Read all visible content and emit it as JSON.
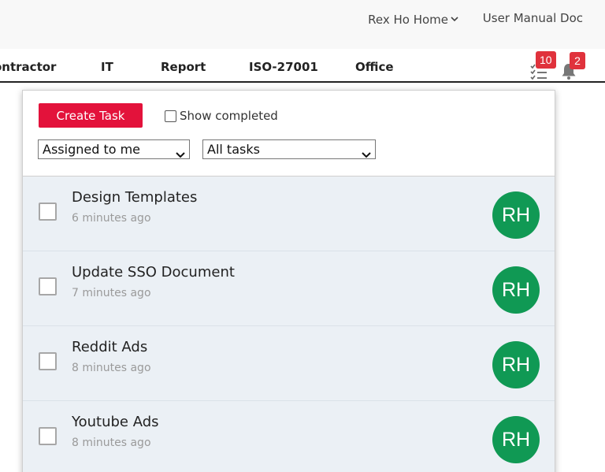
{
  "topbar": {
    "home_label": "Rex Ho Home",
    "manual_label": "User Manual Doc"
  },
  "nav": {
    "items": [
      {
        "label": "ontractor"
      },
      {
        "label": "IT"
      },
      {
        "label": "Report"
      },
      {
        "label": "ISO-27001"
      },
      {
        "label": "Office"
      }
    ],
    "tasks_badge": "10",
    "notifications_badge": "2"
  },
  "panel": {
    "create_label": "Create Task",
    "show_completed_label": "Show completed",
    "assignee_filter": "Assigned to me",
    "task_filter": "All tasks",
    "tasks": [
      {
        "title": "Design Templates",
        "time": "6 minutes ago",
        "initials": "RH"
      },
      {
        "title": "Update SSO Document",
        "time": "7 minutes ago",
        "initials": "RH"
      },
      {
        "title": "Reddit Ads",
        "time": "8 minutes ago",
        "initials": "RH"
      },
      {
        "title": "Youtube Ads",
        "time": "8 minutes ago",
        "initials": "RH"
      }
    ]
  },
  "colors": {
    "accent": "#e3123b",
    "badge": "#e0323c",
    "avatar": "#109954",
    "task_background": "#ebf0f5"
  },
  "icons": {
    "home_dropdown": "chevron-down-icon",
    "tasks": "checklist-icon",
    "notifications": "bell-icon",
    "filter_dropdown": "chevron-down-icon"
  }
}
